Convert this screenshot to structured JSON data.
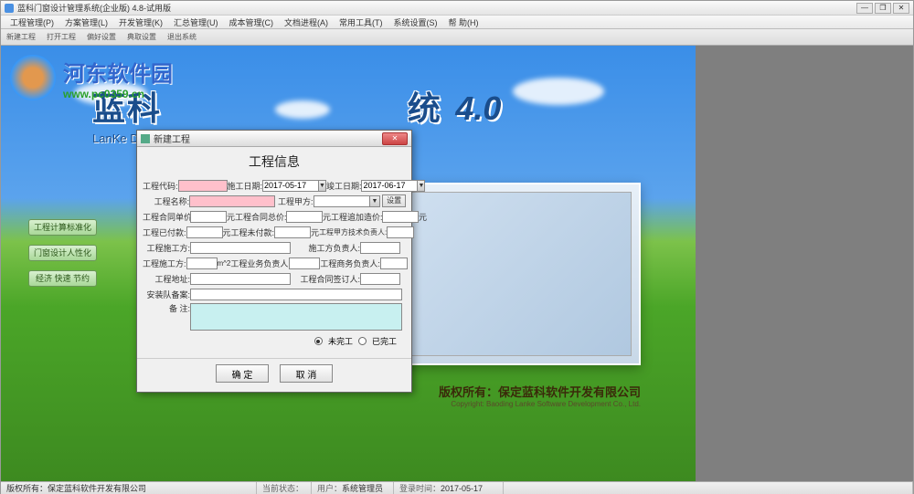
{
  "window": {
    "title": "蓝科门窗设计管理系统(企业版) 4.8-试用版"
  },
  "menu": {
    "items": [
      "工程管理(P)",
      "方案管理(L)",
      "开发管理(K)",
      "汇总管理(U)",
      "成本管理(C)",
      "文档进程(A)",
      "常用工具(T)",
      "系统设置(S)",
      "帮 助(H)"
    ]
  },
  "toolbar": {
    "items": [
      "新建工程",
      "打开工程",
      "偏好设置",
      "典取设置",
      "退出系统"
    ]
  },
  "watermark": {
    "site_cn": "河东软件园",
    "url": "www.pc0359.cn"
  },
  "branding": {
    "title_cn_partial_left": "蓝科",
    "title_cn_partial_right": "统",
    "version": "4.0",
    "subtitle_en": "LanKe Doors"
  },
  "side_buttons": {
    "btn1": "工程计算标准化",
    "btn2": "门窗设计人性化",
    "btn3": "经济  快速  节约"
  },
  "copyright": {
    "cn": "版权所有：保定蓝科软件开发有限公司",
    "en": "Copyright: Baoding Lanke Software Development Co., Ltd."
  },
  "dialog": {
    "title": "新建工程",
    "header": "工程信息",
    "labels": {
      "code": "工程代码:",
      "start_date": "施工日期:",
      "end_date": "竣工日期:",
      "name": "工程名称:",
      "party_a": "工程甲方:",
      "unit_price": "工程合同单价:",
      "total_price": "工程合同总价:",
      "add_price": "工程追加造价:",
      "paid": "工程已付款:",
      "unpaid": "工程未付款:",
      "tech_leader": "工程甲方技术负责人:",
      "constructor": "工程施工方:",
      "const_leader": "施工方负责人:",
      "sqm": "工程施工方:",
      "sqm_unit": "m^2",
      "biz_leader": "工程业务负责人:",
      "trade_leader": "工程商务负责人:",
      "address": "工程地址:",
      "contract_sign": "工程合同签订人:",
      "install_note": "安装队备案:",
      "remark": "备 注:",
      "config_btn": "设置"
    },
    "values": {
      "start_date": "2017-05-17",
      "end_date": "2017-06-17"
    },
    "unit_yuan": "元",
    "radio_unfinished": "未完工",
    "radio_finished": "已完工",
    "btn_ok": "确 定",
    "btn_cancel": "取 消"
  },
  "status": {
    "copyright": "版权所有：保定蓝科软件开发有限公司",
    "state_label": "当前状态：",
    "user_label": "用户：",
    "user_value": "系统管理员",
    "login_label": "登录时间：",
    "login_value": "2017-05-17"
  }
}
